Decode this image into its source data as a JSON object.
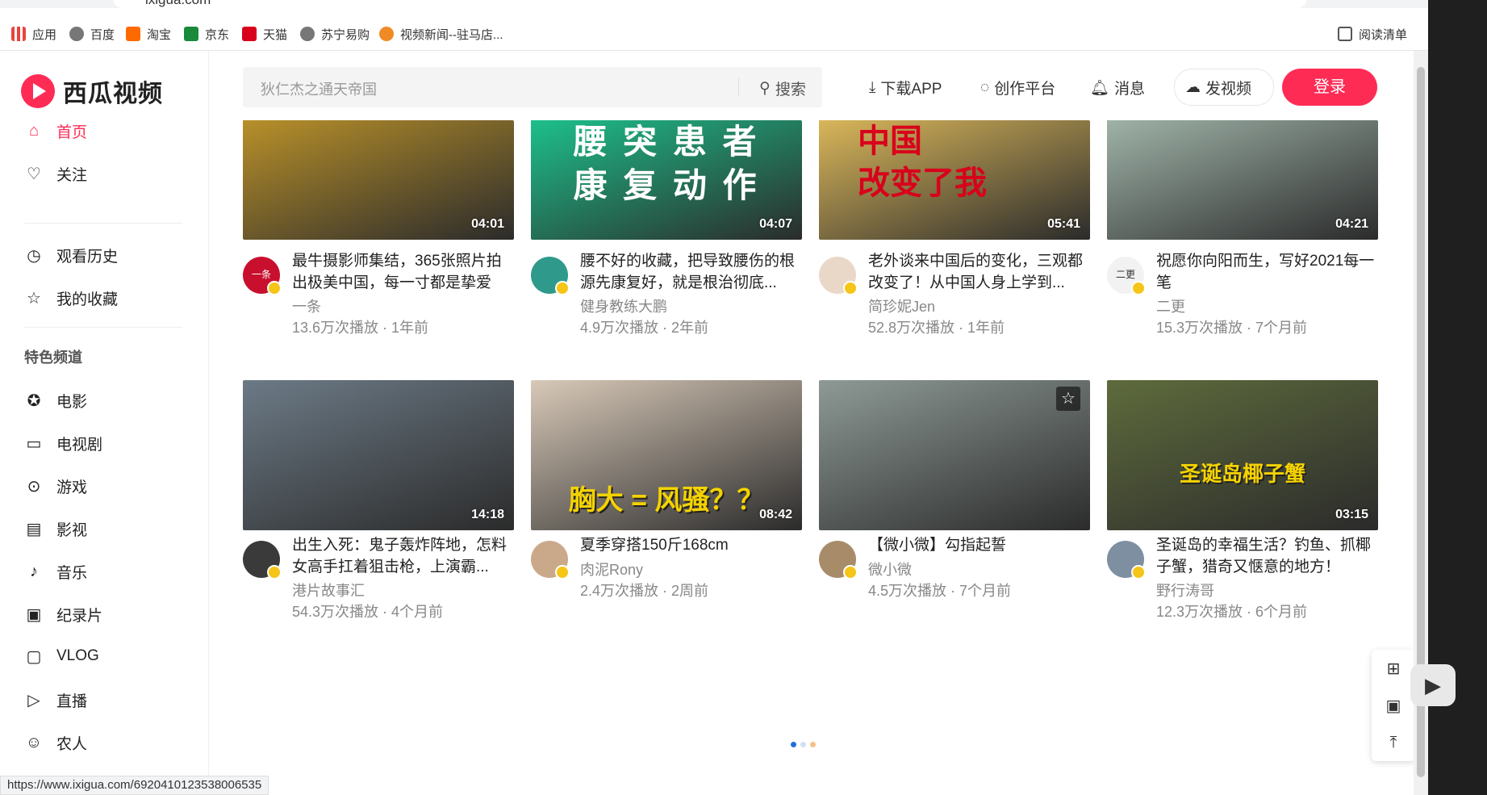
{
  "browser": {
    "url": "ixigua.com",
    "bookmarks": [
      {
        "label": "应用",
        "icon": "apps-icon"
      },
      {
        "label": "百度",
        "icon": "globe-icon"
      },
      {
        "label": "淘宝",
        "icon": "taobao-icon"
      },
      {
        "label": "京东",
        "icon": "jd-icon"
      },
      {
        "label": "天猫",
        "icon": "tmall-icon"
      },
      {
        "label": "苏宁易购",
        "icon": "globe-icon"
      },
      {
        "label": "视频新闻--驻马店...",
        "icon": "news-icon"
      }
    ],
    "reading_list": "阅读清单",
    "status_url": "https://www.ixigua.com/6920410123538006535"
  },
  "logo": {
    "text": "西瓜视频"
  },
  "sidebar": {
    "items": [
      {
        "label": "首页",
        "icon": "home-icon"
      },
      {
        "label": "关注",
        "icon": "heart-icon"
      },
      {
        "label": "观看历史",
        "icon": "clock-icon"
      },
      {
        "label": "我的收藏",
        "icon": "star-icon"
      }
    ],
    "section_title": "特色频道",
    "channels": [
      {
        "label": "电影",
        "icon": "film-reel-icon"
      },
      {
        "label": "电视剧",
        "icon": "tv-icon"
      },
      {
        "label": "游戏",
        "icon": "gamepad-icon"
      },
      {
        "label": "影视",
        "icon": "clapper-icon"
      },
      {
        "label": "音乐",
        "icon": "music-icon"
      },
      {
        "label": "纪录片",
        "icon": "document-icon"
      },
      {
        "label": "VLOG",
        "icon": "camera-icon"
      },
      {
        "label": "直播",
        "icon": "live-icon"
      },
      {
        "label": "农人",
        "icon": "farmer-icon"
      }
    ]
  },
  "header": {
    "search_placeholder": "狄仁杰之通天帝国",
    "search_button": "搜索",
    "download_app": "下载APP",
    "creator": "创作平台",
    "messages": "消息",
    "upload": "发视频",
    "login": "登录"
  },
  "videos": [
    {
      "duration": "04:01",
      "title": "最牛摄影师集结，365张照片拍出极美中国，每一寸都是挚爱",
      "author": "一条",
      "meta": "13.6万次播放 · 1年前",
      "thumb_text": "",
      "thumb_bg": "#b8902a",
      "avatar_bg": "#c8102e",
      "avatar_text": "一条"
    },
    {
      "duration": "04:07",
      "title": "腰不好的收藏，把导致腰伤的根源先康复好，就是根治彻底...",
      "author": "健身教练大鹏",
      "meta": "4.9万次播放 · 2年前",
      "thumb_text": "腰 突 患 者\n康 复 动 作",
      "thumb_bg": "#1dbf8a",
      "avatar_bg": "#2f9a8c",
      "avatar_text": ""
    },
    {
      "duration": "05:41",
      "title": "老外谈来中国后的变化，三观都改变了！从中国人身上学到...",
      "author": "简珍妮Jen",
      "meta": "52.8万次播放 · 1年前",
      "thumb_text": "中国\n改变了我",
      "thumb_bg": "#d9b65a",
      "avatar_bg": "#e9d8c8",
      "avatar_text": ""
    },
    {
      "duration": "04:21",
      "title": "祝愿你向阳而生，写好2021每一笔",
      "author": "二更",
      "meta": "15.3万次播放 · 7个月前",
      "thumb_text": "",
      "thumb_bg": "#9fb3a8",
      "avatar_bg": "#f2f2f2",
      "avatar_text": "二更"
    },
    {
      "duration": "14:18",
      "title": "出生入死：鬼子轰炸阵地，怎料女高手扛着狙击枪，上演霸...",
      "author": "港片故事汇",
      "meta": "54.3万次播放 · 4个月前",
      "thumb_text": "",
      "thumb_bg": "#6c7a86",
      "avatar_bg": "#3a3a3a",
      "avatar_text": ""
    },
    {
      "duration": "08:42",
      "title": "夏季穿搭150斤168cm",
      "author": "肉泥Rony",
      "meta": "2.4万次播放 · 2周前",
      "thumb_text": "胸大 = 风骚？？",
      "thumb_bg": "#d8c9b8",
      "avatar_bg": "#caa98a",
      "avatar_text": ""
    },
    {
      "duration": "",
      "title": "【微小微】勾指起誓",
      "author": "微小微",
      "meta": "4.5万次播放 · 7个月前",
      "thumb_text": "",
      "thumb_bg": "#8e9a96",
      "avatar_bg": "#a88c6a",
      "avatar_text": ""
    },
    {
      "duration": "03:15",
      "title": "圣诞岛的幸福生活？钓鱼、抓椰子蟹，猎奇又惬意的地方！",
      "author": "野行涛哥",
      "meta": "12.3万次播放 · 6个月前",
      "thumb_text": "圣诞岛椰子蟹",
      "thumb_bg": "#5e6b3c",
      "avatar_bg": "#7d8fa0",
      "avatar_text": ""
    }
  ],
  "colors": {
    "accent": "#fe2c55",
    "dot_active": "#1f6fde",
    "dot_inactive": "#cfe0f5",
    "dot_orange": "#f5c08a"
  }
}
